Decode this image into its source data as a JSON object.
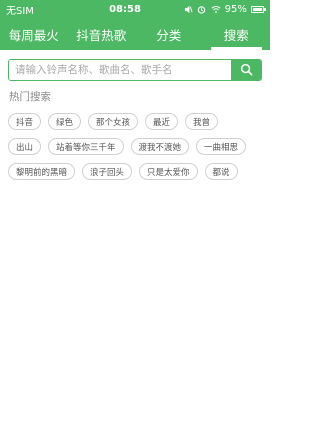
{
  "status_bar": {
    "carrier": "无SIM",
    "time": "08:58",
    "battery": "95%",
    "battery_level": 0.95
  },
  "tabs": [
    {
      "label": "每周最火",
      "active": false
    },
    {
      "label": "抖音热歌",
      "active": false
    },
    {
      "label": "分类",
      "active": false
    },
    {
      "label": "搜索",
      "active": true
    }
  ],
  "search": {
    "placeholder": "请输入铃声名称、歌曲名、歌手名",
    "value": ""
  },
  "hot_search": {
    "title": "热门搜索",
    "rows": [
      [
        "抖音",
        "绿色",
        "那个女孩",
        "最近",
        "我曾"
      ],
      [
        "出山",
        "站着等你三千年",
        "渡我不渡她",
        "一曲相思"
      ],
      [
        "黎明前的黑暗",
        "浪子回头",
        "只是太爱你",
        "都说"
      ]
    ]
  },
  "colors": {
    "accent": "#4cb863"
  }
}
